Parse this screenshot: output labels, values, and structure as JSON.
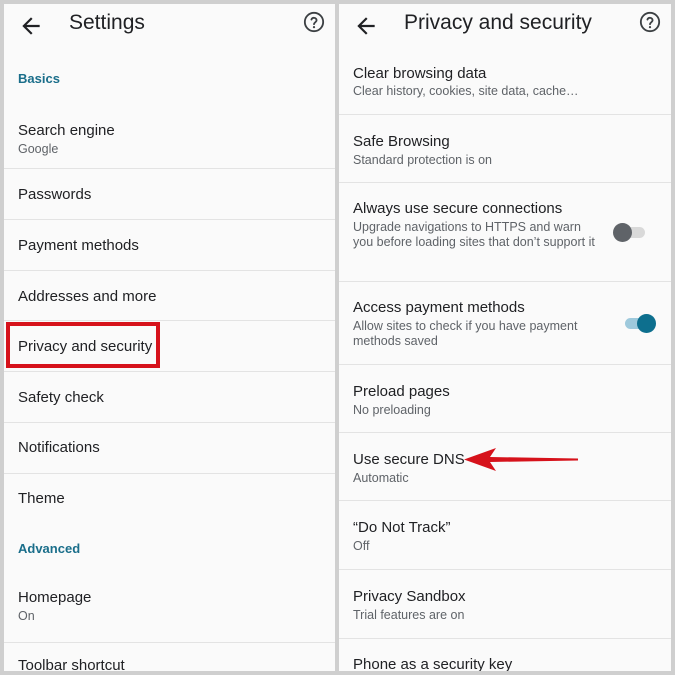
{
  "left": {
    "title": "Settings",
    "sections": {
      "basics": "Basics",
      "advanced": "Advanced"
    },
    "items": [
      {
        "title": "Search engine",
        "sub": "Google"
      },
      {
        "title": "Passwords"
      },
      {
        "title": "Payment methods"
      },
      {
        "title": "Addresses and more"
      },
      {
        "title": "Privacy and security"
      },
      {
        "title": "Safety check"
      },
      {
        "title": "Notifications"
      },
      {
        "title": "Theme"
      },
      {
        "title": "Homepage",
        "sub": "On"
      },
      {
        "title": "Toolbar shortcut"
      }
    ]
  },
  "right": {
    "title": "Privacy and security",
    "items": [
      {
        "title": "Clear browsing data",
        "sub": "Clear history, cookies, site data, cache…"
      },
      {
        "title": "Safe Browsing",
        "sub": "Standard protection is on"
      },
      {
        "title": "Always use secure connections",
        "sub": "Upgrade navigations to HTTPS and warn you before loading sites that don’t support it",
        "toggle": false
      },
      {
        "title": "Access payment methods",
        "sub": "Allow sites to check if you have payment methods saved",
        "toggle": true
      },
      {
        "title": "Preload pages",
        "sub": "No preloading"
      },
      {
        "title": "Use secure DNS",
        "sub": "Automatic"
      },
      {
        "title": "“Do Not Track”",
        "sub": "Off"
      },
      {
        "title": "Privacy Sandbox",
        "sub": "Trial features are on"
      },
      {
        "title": "Phone as a security key"
      }
    ]
  },
  "icons": {
    "back": "arrow-back-icon",
    "help": "help-circle-icon"
  },
  "colors": {
    "accent": "#1a6e8a",
    "highlight": "#d6121b",
    "toggle_on": "#0d6f8e"
  }
}
